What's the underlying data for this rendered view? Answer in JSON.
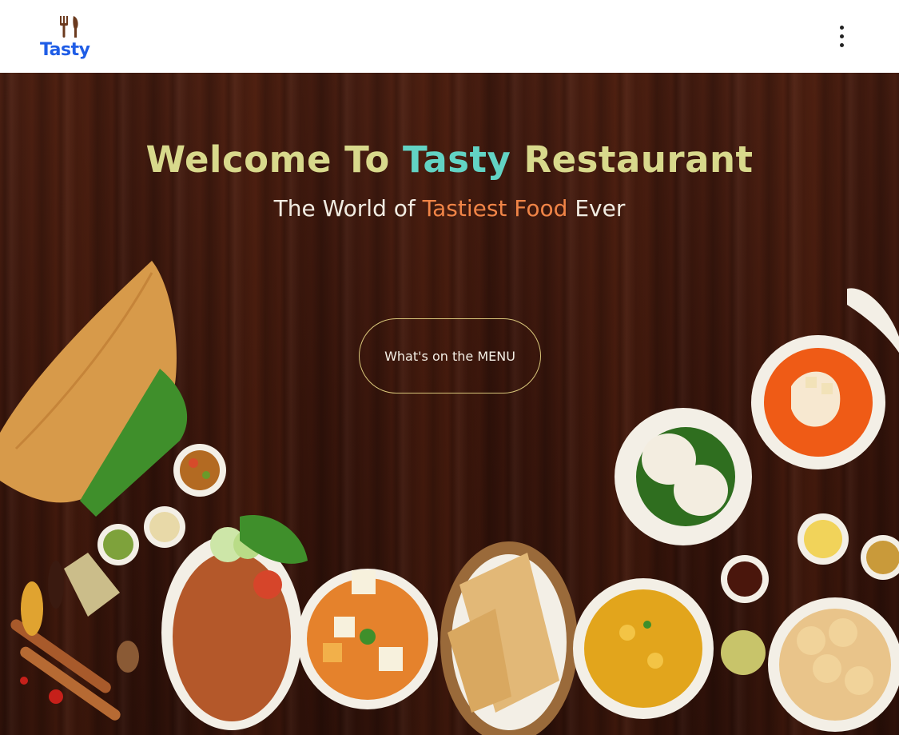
{
  "header": {
    "brand_name": "Tasty",
    "brand_color": "#1f5de6",
    "menu_icon": "kebab-menu-icon"
  },
  "hero": {
    "title_prefix": "Welcome To ",
    "title_accent": "Tasty",
    "title_suffix": " Restaurant",
    "subtitle_prefix": "The World of ",
    "subtitle_accent": "Tastiest Food",
    "subtitle_suffix": " Ever",
    "cta_label": "What's on the MENU",
    "colors": {
      "title": "#d8d98c",
      "title_accent": "#62d3c4",
      "subtitle": "#f1ece2",
      "subtitle_accent": "#f08447",
      "background": "#3a160c"
    }
  },
  "dishes": [
    "dosa-image",
    "sambar-bowl-image",
    "chutney-bowls-image",
    "spices-image",
    "vegetable-pakora-plate-image",
    "paneer-curry-bowl-image",
    "naan-basket-image",
    "aloo-sabzi-bowl-image",
    "idli-plate-image",
    "tomato-soup-bowl-image",
    "puri-plate-image",
    "side-condiment-bowls-image"
  ]
}
